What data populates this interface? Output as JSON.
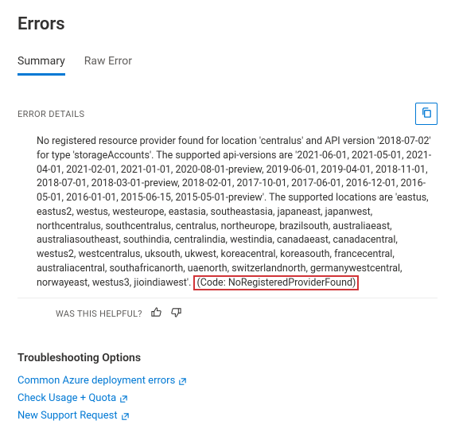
{
  "header": {
    "title": "Errors"
  },
  "tabs": {
    "summary": "Summary",
    "raw": "Raw Error"
  },
  "section": {
    "label": "ERROR DETAILS"
  },
  "error": {
    "message_pre": "No registered resource provider found for location 'centralus' and API version '2018-07-02' for type 'storageAccounts'. The supported api-versions are '2021-06-01, 2021-05-01, 2021-04-01, 2021-02-01, 2021-01-01, 2020-08-01-preview, 2019-06-01, 2019-04-01, 2018-11-01, 2018-07-01, 2018-03-01-preview, 2018-02-01, 2017-10-01, 2017-06-01, 2016-12-01, 2016-05-01, 2016-01-01, 2015-06-15, 2015-05-01-preview'. The supported locations are 'eastus, eastus2, westus, westeurope, eastasia, southeastasia, japaneast, japanwest, northcentralus, southcentralus, centralus, northeurope, brazilsouth, australiaeast, australiasoutheast, southindia, centralindia, westindia, canadaeast, canadacentral, westus2, westcentralus, uksouth, ukwest, koreacentral, koreasouth, francecentral, australiacentral, southafricanorth, uaenorth, switzerlandnorth, germanywestcentral, norwayeast, westus3, jioindiawest'. ",
    "code": "(Code: NoRegisteredProviderFound)"
  },
  "helpful": {
    "label": "WAS THIS HELPFUL?"
  },
  "troubleshoot": {
    "heading": "Troubleshooting Options",
    "link1": "Common Azure deployment errors",
    "link2": "Check Usage + Quota",
    "link3": "New Support Request"
  }
}
